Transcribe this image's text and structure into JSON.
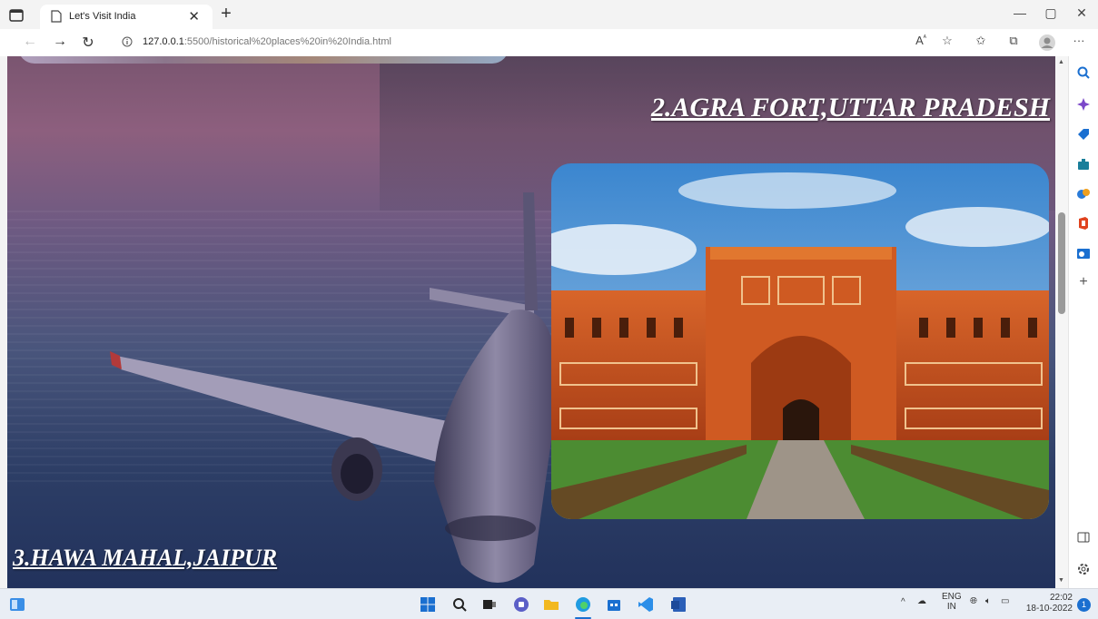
{
  "browser": {
    "tab_title": "Let's Visit India",
    "tab_close": "✕",
    "new_tab": "+",
    "url_host": "127.0.0.1",
    "url_rest": ":5500/historical%20places%20in%20India.html",
    "window_controls": {
      "minimize": "—",
      "restore": "▢",
      "close": "✕"
    }
  },
  "page": {
    "heading_agra": "2.AGRA FORT,UTTAR PRADESH",
    "heading_hawa": "3.HAWA MAHAL,JAIPUR"
  },
  "taskbar": {
    "language": "ENG",
    "region": "IN",
    "time": "22:02",
    "date": "18-10-2022",
    "notifications": "1"
  },
  "colors": {
    "accent": "#1a6fd0",
    "heading": "#ffffff",
    "fort": "#c4511d"
  }
}
